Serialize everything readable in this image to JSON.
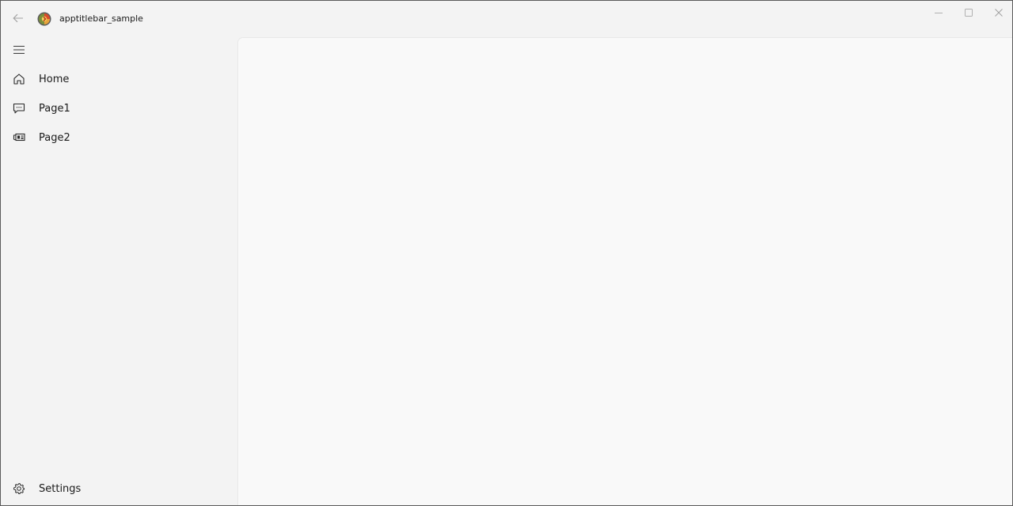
{
  "window": {
    "title": "apptitlebar_sample"
  },
  "icons": {
    "back": "back-arrow-icon",
    "logo": "app-logo-icon",
    "minimize": "minimize-icon",
    "maximize": "maximize-icon",
    "close": "close-icon",
    "menu": "hamburger-menu-icon",
    "home": "home-icon",
    "page1": "chat-bubble-icon",
    "page2": "news-icon",
    "settings": "gear-icon"
  },
  "nav": {
    "items": [
      {
        "label": "Home"
      },
      {
        "label": "Page1"
      },
      {
        "label": "Page2"
      }
    ],
    "footer": {
      "settings_label": "Settings"
    }
  },
  "colors": {
    "window_bg": "#f3f3f3",
    "content_bg": "#f9f9f9"
  }
}
